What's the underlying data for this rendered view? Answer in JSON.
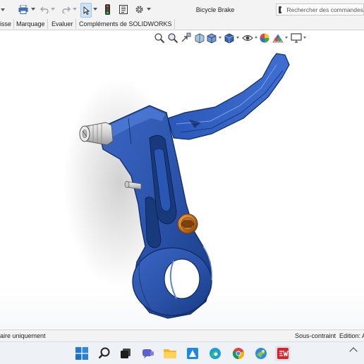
{
  "window": {
    "title": "Bicycle Brake"
  },
  "search": {
    "placeholder": "Rechercher des commandes"
  },
  "tabs": [
    {
      "label": "isse"
    },
    {
      "label": "Marquage"
    },
    {
      "label": "Evaluer"
    },
    {
      "label": "Compléments de SOLIDWORKS"
    }
  ],
  "status": {
    "left": "aire uniquement",
    "constraint": "Sous-contraint",
    "edition": "Edition: A"
  },
  "colors": {
    "part": "#2a52a8",
    "accent": "#d9822b"
  },
  "taskbar": {
    "icons": [
      "windows-start-icon",
      "search-icon",
      "task-view-icon",
      "teams-chat-icon",
      "file-explorer-icon",
      "paint-icon",
      "edge-icon",
      "chrome-icon",
      "app-icon",
      "solidworks-icon"
    ]
  }
}
